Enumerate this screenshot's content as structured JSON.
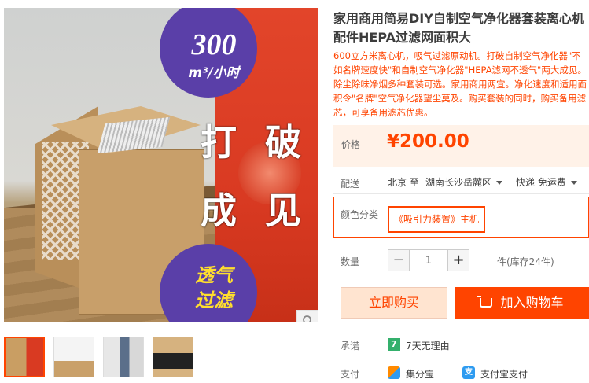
{
  "gallery": {
    "overlay": {
      "speed_number": "300",
      "speed_unit": "m³/小时",
      "headline_line1": "打 破",
      "headline_line2": "成 见",
      "badge_line1": "透气",
      "badge_line2": "过滤"
    },
    "zoom_icon": "magnifier-icon",
    "thumbnails": [
      "thumb-1",
      "thumb-2",
      "thumb-3",
      "thumb-4"
    ],
    "active_thumbnail": 1
  },
  "product": {
    "title": "家用商用简易DIY自制空气净化器套装离心机配件HEPA过滤网面积大",
    "subtitle": "600立方米离心机，吸气过滤原动机。打破自制空气净化器\"不如名牌速度快\"和自制空气净化器\"HEPA滤网不透气\"两大成见。除尘除味净烟多种套装可选。家用商用两宜。净化速度和适用面积令\"名牌\"空气净化器望尘莫及。购买套装的同时，购买备用滤芯，可享备用滤芯优惠。"
  },
  "price": {
    "label": "价格",
    "value": "¥200.00"
  },
  "shipping": {
    "label": "配送",
    "from": "北京",
    "to_word": "至",
    "destination": "湖南长沙岳麓区",
    "method": "快递 免运费"
  },
  "color": {
    "label": "颜色分类",
    "selected_option": "《吸引力装置》主机"
  },
  "quantity": {
    "label": "数量",
    "value": "1",
    "minus": "−",
    "plus": "+",
    "stock": "件(库存24件)"
  },
  "actions": {
    "buy_now": "立即购买",
    "add_to_cart": "加入购物车"
  },
  "promise": {
    "label": "承诺",
    "badge": "7",
    "text": "7天无理由"
  },
  "payment": {
    "label": "支付",
    "method1": "集分宝",
    "method2_icon_text": "支",
    "method2": "支付宝支付"
  },
  "colors": {
    "accent": "#ff4400",
    "price_bg": "#fff2e8",
    "promo_purple": "#5a3fa8",
    "promo_red": "#d93a22"
  }
}
